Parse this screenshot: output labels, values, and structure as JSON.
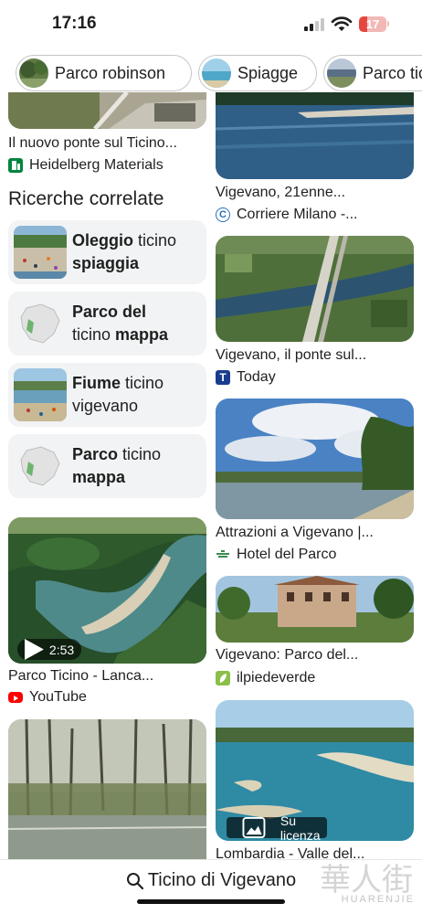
{
  "status_bar": {
    "time": "17:16",
    "battery": "17"
  },
  "chips": [
    {
      "label": "Parco robinson"
    },
    {
      "label": "Spiagge"
    },
    {
      "label": "Parco ticino"
    }
  ],
  "left_column": {
    "top_result": {
      "title": "Il nuovo ponte sul Ticino...",
      "source": "Heidelberg Materials"
    },
    "related_heading": "Ricerche correlate",
    "related": [
      {
        "bold1": "Oleggio",
        "normal1": " ticino",
        "bold2": "spiaggia",
        "normal2": ""
      },
      {
        "bold1": "Parco del",
        "normal1": "",
        "bold2": "",
        "normal2": "ticino ",
        "bold3": "mappa"
      },
      {
        "bold1": "Fiume",
        "normal1": " ticino",
        "bold2": "",
        "normal2": "vigevano"
      },
      {
        "bold1": "Parco",
        "normal1": " ticino",
        "bold2": "mappa",
        "normal2": ""
      }
    ],
    "video": {
      "duration": "2:53",
      "title": "Parco Ticino - Lanca...",
      "source": "YouTube"
    }
  },
  "right_column": {
    "results": [
      {
        "title": "Vigevano, 21enne...",
        "source": "Corriere Milano -..."
      },
      {
        "title": "Vigevano, il ponte sul...",
        "source": "Today"
      },
      {
        "title": "Attrazioni a Vigevano |...",
        "source": "Hotel del Parco"
      },
      {
        "title": "Vigevano: Parco del...",
        "source": "ilpiedeverde"
      },
      {
        "title": "Lombardia - Valle del...",
        "license": "Su licenza"
      }
    ]
  },
  "bottom_bar": {
    "query": "Ticino di Vigevano"
  },
  "watermark": {
    "logo_text": "華人街",
    "url_text": "HUARENJIE"
  },
  "colors": {
    "chip_border": "#c4c7c5",
    "related_bg": "#f1f3f4",
    "youtube_red": "#ff0000",
    "today_blue": "#1a3c8f",
    "heidelberg_green": "#00843d"
  }
}
